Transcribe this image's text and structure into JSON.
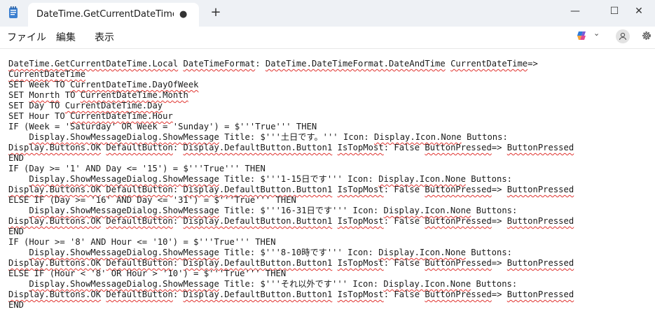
{
  "window": {
    "tab_title": "DateTime.GetCurrentDateTime.Loca",
    "modified_marker": "●",
    "new_tab_glyph": "+",
    "minimize_glyph": "—",
    "maximize_glyph": "☐",
    "close_glyph": "✕"
  },
  "menu": [
    "ファイル",
    "編集",
    "表示"
  ],
  "toolbar": {
    "copilot_chevron": "⌄"
  },
  "colors": {
    "titlebar": "#eef1f5",
    "squiggle": "#e0322e",
    "text": "#1a1a1a"
  },
  "editor": {
    "lines": [
      "DateTime.GetCurrentDateTime.Local DateTimeFormat: DateTime.DateTimeFormat.DateAndTime CurrentDateTime=>",
      "CurrentDateTime",
      "SET Week TO CurrentDateTime.DayOfWeek",
      "SET Monrth TO CurrentDateTime.Month",
      "SET Day TO CurrentDateTime.Day",
      "SET Hour TO CurrentDateTime.Hour",
      "IF (Week = 'Saturday' OR Week = 'Sunday') = $'''True''' THEN",
      "    Display.ShowMessageDialog.ShowMessage Title: $'''土日です。''' Icon: Display.Icon.None Buttons:",
      "Display.Buttons.OK DefaultButton: Display.DefaultButton.Button1 IsTopMost: False ButtonPressed=> ButtonPressed",
      "END",
      "IF (Day >= '1' AND Day <= '15') = $'''True''' THEN",
      "    Display.ShowMessageDialog.ShowMessage Title: $'''1-15日です''' Icon: Display.Icon.None Buttons:",
      "Display.Buttons.OK DefaultButton: Display.DefaultButton.Button1 IsTopMost: False ButtonPressed=> ButtonPressed",
      "ELSE IF (Day >= '16' AND Day <= '31') = $'''True''' THEN",
      "    Display.ShowMessageDialog.ShowMessage Title: $'''16-31日です''' Icon: Display.Icon.None Buttons:",
      "Display.Buttons.OK DefaultButton: Display.DefaultButton.Button1 IsTopMost: False ButtonPressed=> ButtonPressed",
      "END",
      "IF (Hour >= '8' AND Hour <= '10') = $'''True''' THEN",
      "    Display.ShowMessageDialog.ShowMessage Title: $'''8-10時です''' Icon: Display.Icon.None Buttons:",
      "Display.Buttons.OK DefaultButton: Display.DefaultButton.Button1 IsTopMost: False ButtonPressed=> ButtonPressed",
      "ELSE IF (Hour < '8' OR Hour > '10') = $'''True''' THEN",
      "    Display.ShowMessageDialog.ShowMessage Title: $'''それ以外です''' Icon: Display.Icon.None Buttons:",
      "Display.Buttons.OK DefaultButton: Display.DefaultButton.Button1 IsTopMost: False ButtonPressed=> ButtonPressed",
      "END"
    ]
  }
}
